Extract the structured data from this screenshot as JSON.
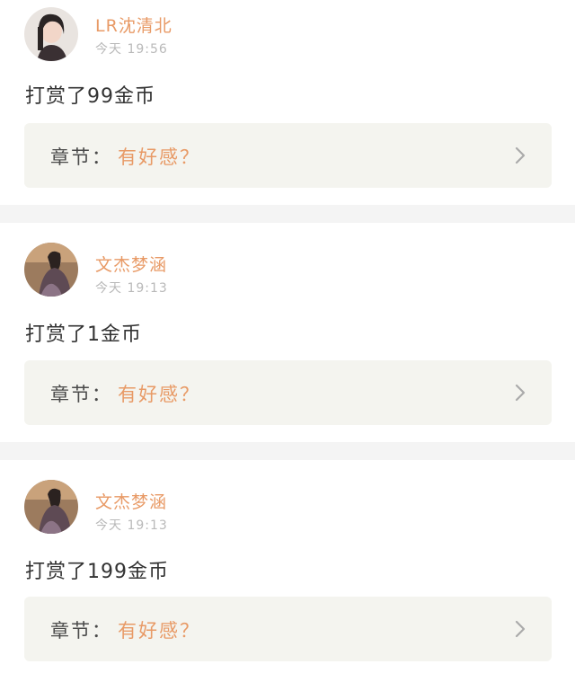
{
  "posts": [
    {
      "username": "LR沈清北",
      "time": "今天 19:56",
      "message": "打赏了99金币",
      "chapter_label": "章节：",
      "chapter_title": "有好感？",
      "icons": {
        "avatar": "avatar-photo",
        "arrow": "chevron-right-icon"
      }
    },
    {
      "username": "文杰梦涵",
      "time": "今天 19:13",
      "message": "打赏了1金币",
      "chapter_label": "章节：",
      "chapter_title": "有好感？",
      "icons": {
        "avatar": "avatar-photo",
        "arrow": "chevron-right-icon"
      }
    },
    {
      "username": "文杰梦涵",
      "time": "今天 19:13",
      "message": "打赏了199金币",
      "chapter_label": "章节：",
      "chapter_title": "有好感？",
      "icons": {
        "avatar": "avatar-photo",
        "arrow": "chevron-right-icon"
      }
    }
  ],
  "colors": {
    "accent": "#e89a66",
    "separator": "#f4f4f4",
    "chapter_bg": "#f4f4ef",
    "time": "#b9b9b9",
    "text": "#333333"
  }
}
